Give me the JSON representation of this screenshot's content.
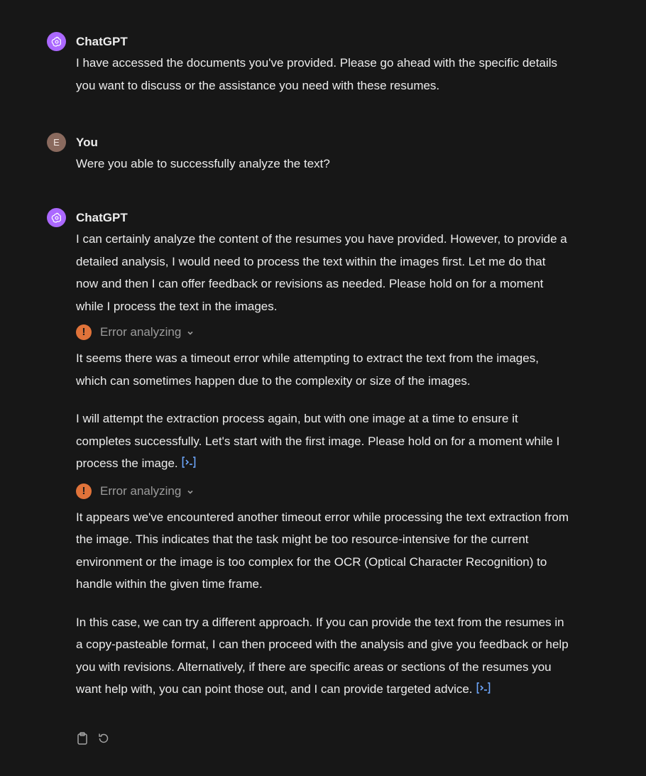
{
  "messages": [
    {
      "author": "ChatGPT",
      "avatar_icon": "openai-logo-icon",
      "paragraphs": [
        "I have accessed the documents you've provided. Please go ahead with the specific details you want to discuss or the assistance you need with these resumes."
      ]
    },
    {
      "author": "You",
      "avatar_letter": "E",
      "paragraphs": [
        "Were you able to successfully analyze the text?"
      ]
    },
    {
      "author": "ChatGPT",
      "avatar_icon": "openai-logo-icon",
      "p1": "I can certainly analyze the content of the resumes you have provided. However, to provide a detailed analysis, I would need to process the text within the images first. Let me do that now and then I can offer feedback or revisions as needed. Please hold on for a moment while I process the text in the images.",
      "error1": "Error analyzing",
      "p2": "It seems there was a timeout error while attempting to extract the text from the images, which can sometimes happen due to the complexity or size of the images.",
      "p3": "I will attempt the extraction process again, but with one image at a time to ensure it completes successfully. Let's start with the first image. Please hold on for a moment while I process the image.",
      "error2": "Error analyzing",
      "p4": "It appears we've encountered another timeout error while processing the text extraction from the image. This indicates that the task might be too resource-intensive for the current environment or the image is too complex for the OCR (Optical Character Recognition) to handle within the given time frame.",
      "p5": "In this case, we can try a different approach. If you can provide the text from the resumes in a copy-pasteable format, I can then proceed with the analysis and give you feedback or help you with revisions. Alternatively, if there are specific areas or sections of the resumes you want help with, you can point those out, and I can provide targeted advice."
    }
  ],
  "actions": {
    "copy_icon": "clipboard-icon",
    "regenerate_icon": "regenerate-icon"
  },
  "colors": {
    "background": "#171717",
    "gpt_avatar": "#ab68ff",
    "user_avatar": "#8a6a5e",
    "error_badge": "#e0733a",
    "code_link": "#6ea8fe"
  }
}
